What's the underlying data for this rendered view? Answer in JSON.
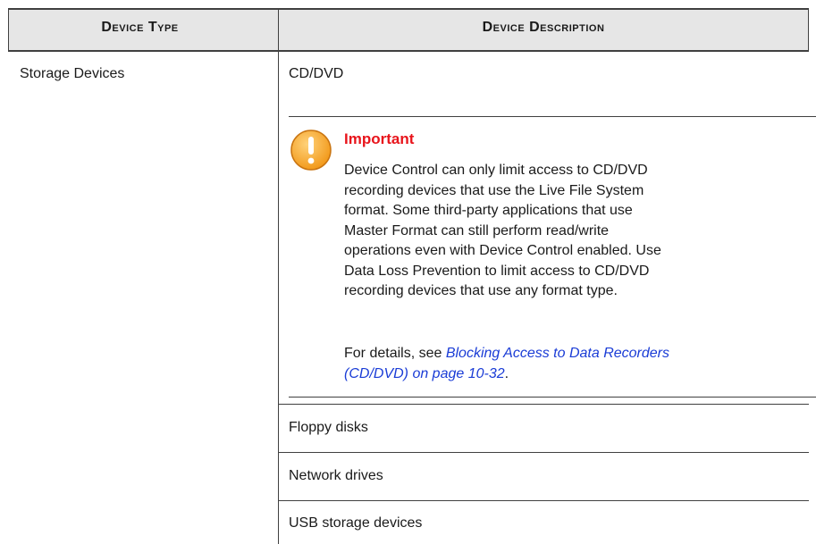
{
  "table": {
    "headers": [
      "Device Type",
      "Device Description"
    ],
    "device_type": "Storage Devices",
    "rows": {
      "cd_dvd": "CD/DVD",
      "floppy": "Floppy disks",
      "network": "Network drives",
      "usb": "USB storage devices"
    }
  },
  "note": {
    "icon": "warning-exclamation-icon",
    "title": "Important",
    "body_lines": [
      "Device Control can only limit access to CD/DVD",
      "recording devices that use the Live File System",
      "format. Some third-party applications that use",
      "Master Format can still perform read/write",
      "operations even with Device Control enabled. Use",
      "Data Loss Prevention to limit access to CD/DVD",
      "recording devices that use any format type."
    ],
    "details_prefix": "For details, see ",
    "details_link_line1": "Blocking Access to Data Recorders",
    "details_link_line2": "(CD/DVD) on page 10-32",
    "details_suffix": "."
  },
  "colors": {
    "header_bg": "#e6e6e6",
    "important_red": "#e8141b",
    "link_blue": "#1a3cd6",
    "icon_orange": "#f5a623"
  }
}
